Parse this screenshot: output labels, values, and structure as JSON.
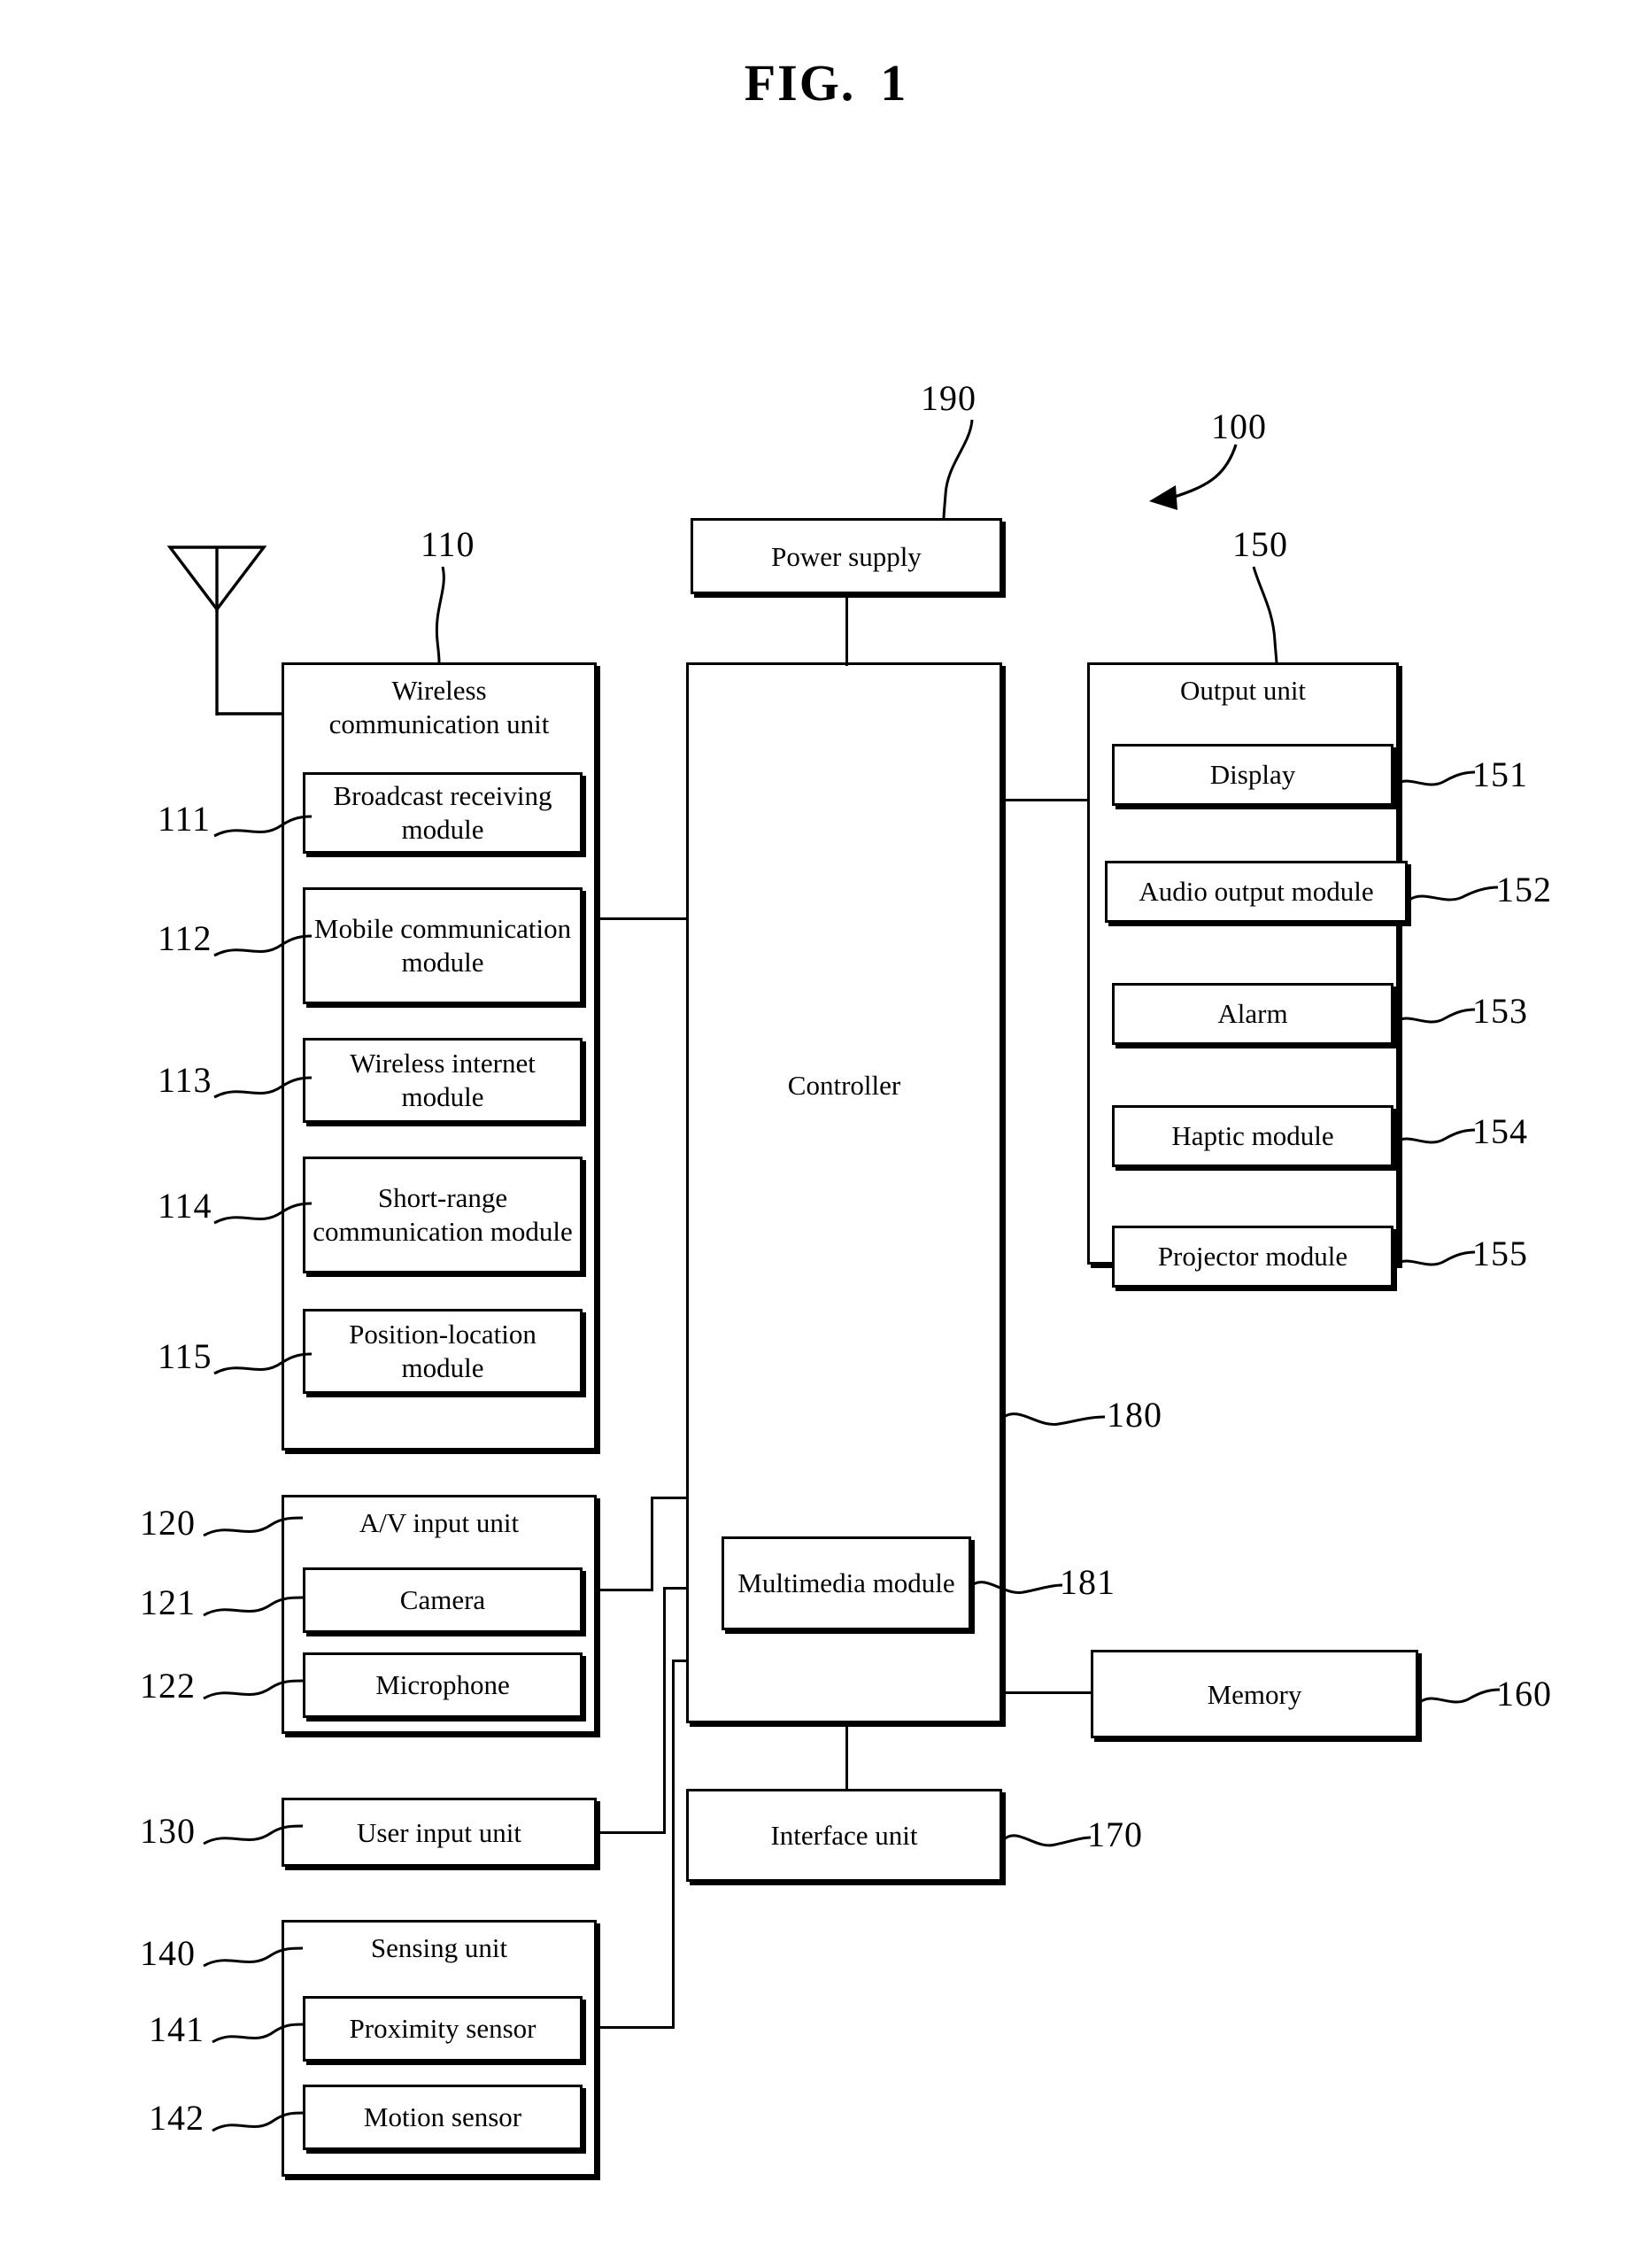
{
  "figure": {
    "title": "FIG. 1",
    "title_word": "FIG.",
    "title_number": "1"
  },
  "refs": {
    "device": "100",
    "wireless_unit": "110",
    "broadcast": "111",
    "mobile": "112",
    "wireless_internet": "113",
    "short_range": "114",
    "position_location": "115",
    "av_input": "120",
    "camera": "121",
    "microphone": "122",
    "user_input": "130",
    "sensing": "140",
    "proximity": "141",
    "motion": "142",
    "output_unit": "150",
    "display": "151",
    "audio_output": "152",
    "alarm": "153",
    "haptic": "154",
    "projector": "155",
    "memory": "160",
    "interface": "170",
    "controller": "180",
    "multimedia": "181",
    "power_supply": "190"
  },
  "blocks": {
    "power_supply": {
      "label": "Power supply"
    },
    "controller": {
      "label": "Controller"
    },
    "multimedia_module": {
      "label": "Multimedia module"
    },
    "memory": {
      "label": "Memory"
    },
    "interface_unit": {
      "label": "Interface unit"
    },
    "user_input_unit": {
      "label": "User input unit"
    },
    "wireless_communication_unit": {
      "title_line1": "Wireless",
      "title_line2": "communication unit",
      "modules": [
        {
          "label": "Broadcast receiving module",
          "ref": "111"
        },
        {
          "label": "Mobile communication module",
          "ref": "112"
        },
        {
          "label": "Wireless internet module",
          "ref": "113"
        },
        {
          "label": "Short-range communication module",
          "ref": "114"
        },
        {
          "label": "Position-location module",
          "ref": "115"
        }
      ]
    },
    "av_input_unit": {
      "title": "A/V input unit",
      "modules": [
        {
          "label": "Camera",
          "ref": "121"
        },
        {
          "label": "Microphone",
          "ref": "122"
        }
      ]
    },
    "sensing_unit": {
      "title": "Sensing unit",
      "modules": [
        {
          "label": "Proximity sensor",
          "ref": "141"
        },
        {
          "label": "Motion sensor",
          "ref": "142"
        }
      ]
    },
    "output_unit": {
      "title": "Output unit",
      "modules": [
        {
          "label": "Display",
          "ref": "151"
        },
        {
          "label": "Audio output module",
          "ref": "152"
        },
        {
          "label": "Alarm",
          "ref": "153"
        },
        {
          "label": "Haptic module",
          "ref": "154"
        },
        {
          "label": "Projector module",
          "ref": "155"
        }
      ]
    }
  },
  "icons": {
    "antenna": "antenna-icon",
    "device_arrow": "curved-arrow-icon"
  },
  "colors": {
    "stroke": "#000000",
    "background": "#ffffff"
  }
}
